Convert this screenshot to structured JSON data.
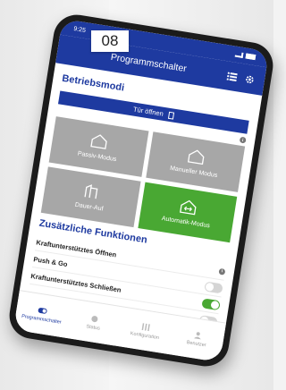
{
  "step_badge": "08",
  "status_bar": {
    "time": "9:25"
  },
  "header": {
    "title": "Programmschalter",
    "list_icon": "list-icon",
    "settings_icon": "gear-icon"
  },
  "modes": {
    "section_title": "Betriebsmodi",
    "door_button": "Tür öffnen",
    "tiles": [
      {
        "label": "Passiv-Modus",
        "icon": "house-icon",
        "active": false
      },
      {
        "label": "Manueller Modus",
        "icon": "house-icon",
        "active": false
      },
      {
        "label": "Dauer-Auf",
        "icon": "open-door-icon",
        "active": false
      },
      {
        "label": "Automatik-Modus",
        "icon": "auto-door-icon",
        "active": true
      }
    ]
  },
  "functions": {
    "section_title": "Zusätzliche Funktionen",
    "rows": [
      {
        "label": "Kraftunterstütztes Öffnen",
        "control": "info",
        "state": null
      },
      {
        "label": "Push & Go",
        "control": "toggle",
        "state": false
      },
      {
        "label": "Kraftunterstütztes Schließen",
        "control": "toggle",
        "state": true
      },
      {
        "label": "",
        "control": "toggle",
        "state": false
      }
    ]
  },
  "bottom_nav": [
    {
      "label": "Programmschalter",
      "active": true
    },
    {
      "label": "Status",
      "active": false
    },
    {
      "label": "Konfiguration",
      "active": false
    },
    {
      "label": "Benutzer",
      "active": false
    }
  ],
  "colors": {
    "primary": "#1e3aa0",
    "active_green": "#49a833",
    "tile_gray": "#a7a7a7"
  }
}
